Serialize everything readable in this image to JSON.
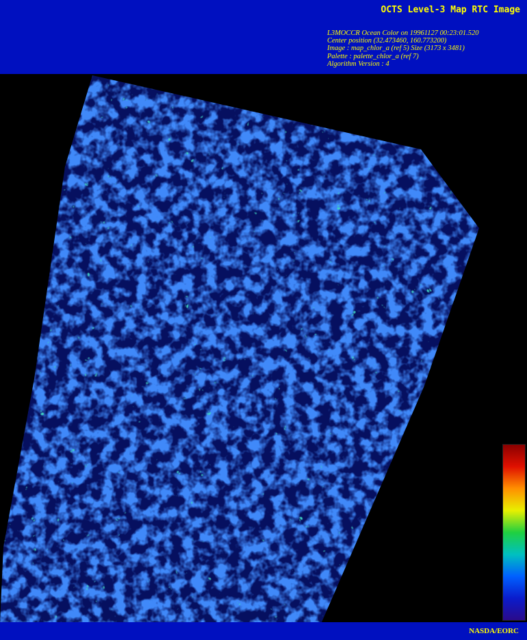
{
  "header": {
    "title": "OCTS Level-3 Map RTC Image",
    "meta_lines": [
      "L3MOCCR Ocean Color on 19961127 00:23:01.520",
      "Center position (32.473460, 160.773200)",
      "Image : map_chlor_a (ref 5) Size (3173 x 3481)",
      "Palette : palette_chlor_a (ref 7)",
      "Algorithm Version : 4"
    ]
  },
  "footer": {
    "credit": "NASDA/EORC"
  },
  "colors": {
    "banner": "#0010c0",
    "text": "#ffff00",
    "background": "#000000"
  },
  "colorbar": {
    "stops": [
      "#2a0a8a",
      "#0a1ccc",
      "#0060ff",
      "#00c0c0",
      "#20d040",
      "#e8f000",
      "#ff9000",
      "#e01000",
      "#8a0000"
    ]
  },
  "image": {
    "description_icon": "satellite-chlorophyll-map"
  }
}
